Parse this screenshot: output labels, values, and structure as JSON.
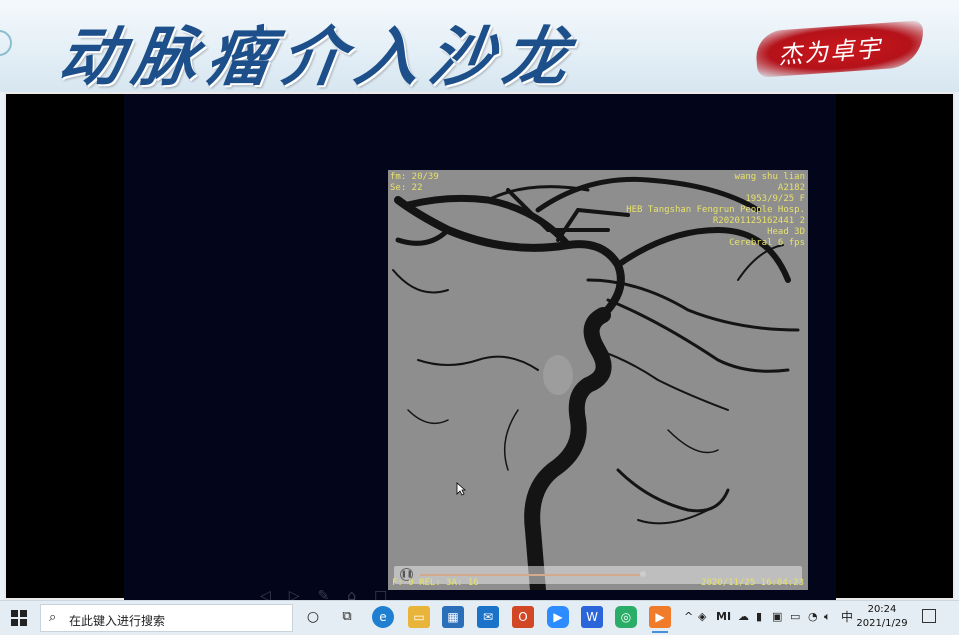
{
  "banner": {
    "title": "动脉瘤介入沙龙",
    "stamp_text": "杰为卓宇"
  },
  "viewer": {
    "overlay_left": [
      "fm: 20/39",
      "Se: 22"
    ],
    "overlay_right": [
      "wang shu lian",
      "A2182",
      "1953/9/25 F",
      "HEB Tangshan Fengrun People Hosp.",
      "R20201125162441 2",
      "Head 3D",
      "Cerebral 6 fps"
    ],
    "bottom_left": "F: 0 REL: 3A: 16",
    "bottom_right": "2020/11/25 16:04:23"
  },
  "taskbar": {
    "search_placeholder": "在此键入进行搜索",
    "ime": "中",
    "time": "20:24",
    "date": "2021/1/29",
    "apps": [
      {
        "name": "task-view",
        "color": "#3b3b3b"
      },
      {
        "name": "edge",
        "color": "#1f7fd1"
      },
      {
        "name": "file-explorer",
        "color": "#e8b53a"
      },
      {
        "name": "store",
        "color": "#2b6fb8"
      },
      {
        "name": "mail",
        "color": "#1a73c8"
      },
      {
        "name": "office",
        "color": "#d24726"
      },
      {
        "name": "zoom",
        "color": "#2d8cff"
      },
      {
        "name": "wps",
        "color": "#2a65d9"
      },
      {
        "name": "wechat",
        "color": "#2aae67"
      },
      {
        "name": "player",
        "color": "#f07b2a"
      }
    ]
  },
  "colors": {
    "banner_title": "#1d4f8a",
    "stamp": "#c9171c",
    "overlay_text": "#e8e26a"
  }
}
